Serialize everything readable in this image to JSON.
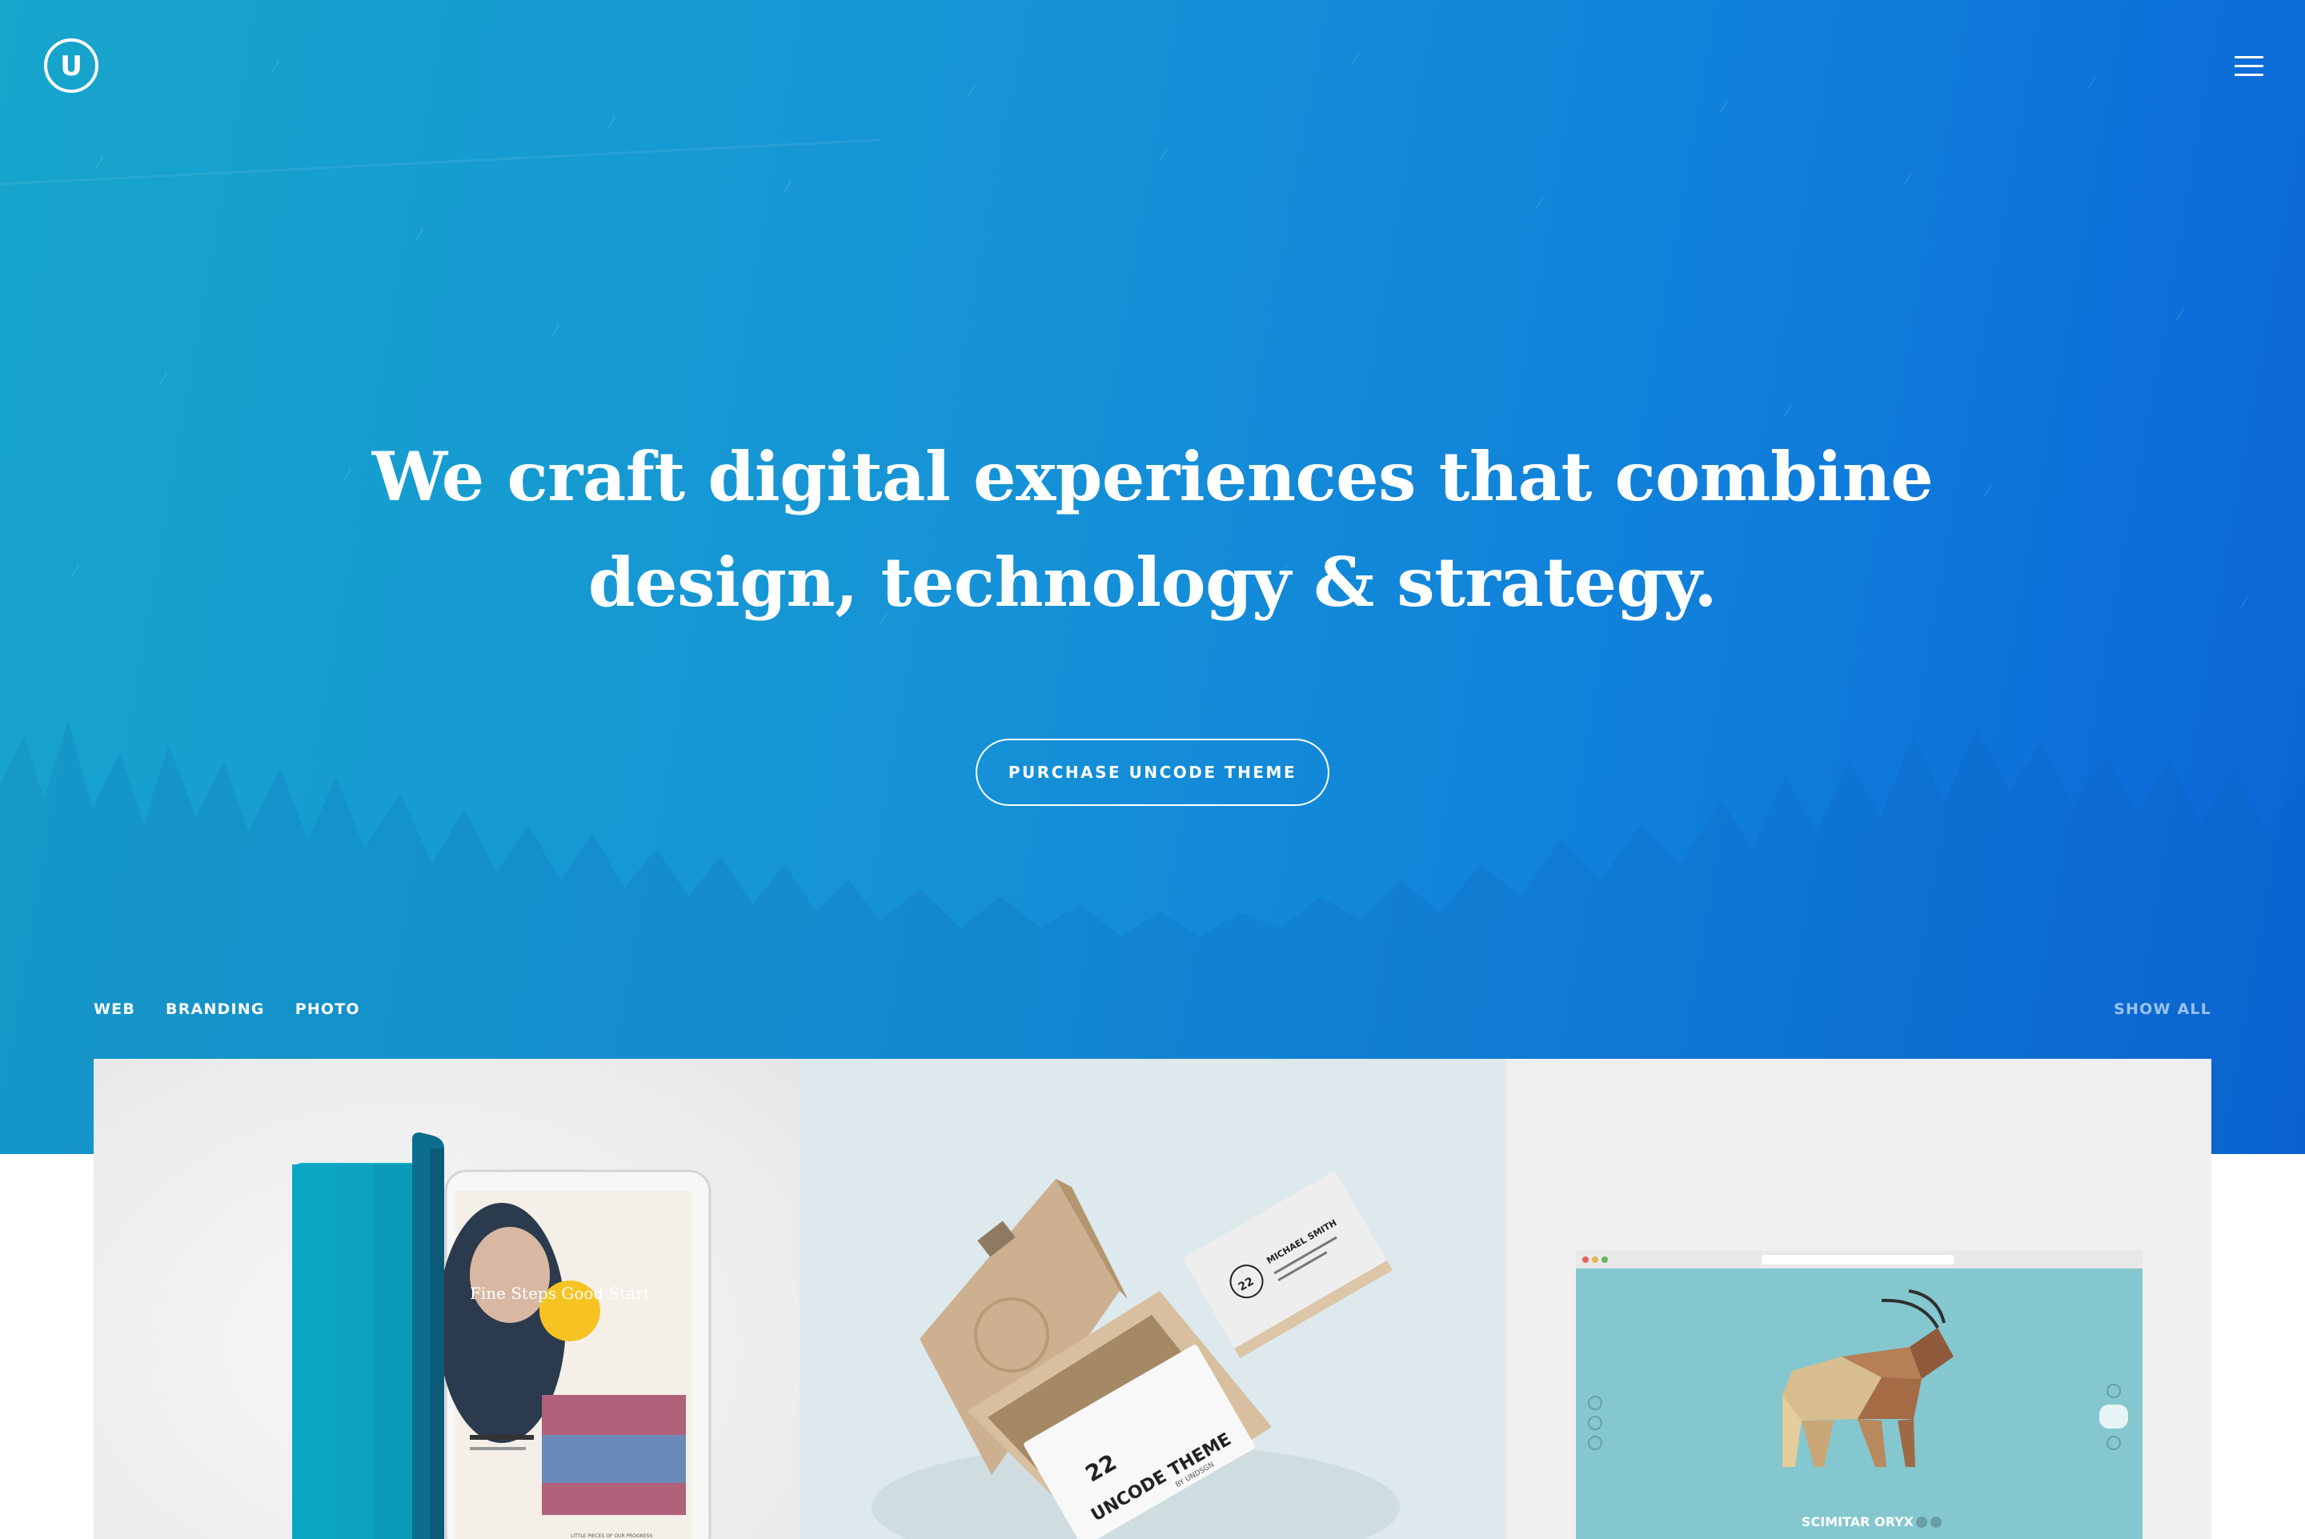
{
  "header": {
    "logo_letter": "U",
    "logo_icon": "uncode-logo-icon",
    "menu_icon": "hamburger-menu-icon"
  },
  "hero": {
    "headline_line1": "We craft digital experiences that combine",
    "headline_line2": "design, technology & strategy.",
    "cta_label": "PURCHASE UNCODE THEME"
  },
  "portfolio": {
    "filters": [
      "WEB",
      "BRANDING",
      "PHOTO"
    ],
    "show_all": "SHOW ALL",
    "items": [
      {
        "label": "tablet-mockup",
        "screen_heading": "Fine Steps Good Start",
        "screen_note": "LITTLE PIECES OF OUR PROGRESS"
      },
      {
        "label": "business-cards-mockup",
        "card_title": "UNCODE THEME",
        "card_byline": "BY UNDSGN",
        "card_number": "22",
        "card_name": "MICHAEL SMITH"
      },
      {
        "label": "browser-mockup",
        "site_caption": "SCIMITAR ORYX"
      }
    ]
  },
  "colors": {
    "hero_start": "#17a5cb",
    "hero_end": "#0a64d6",
    "tablet_cover": "#0aa6c4",
    "browser_bg": "#84c7cf"
  }
}
